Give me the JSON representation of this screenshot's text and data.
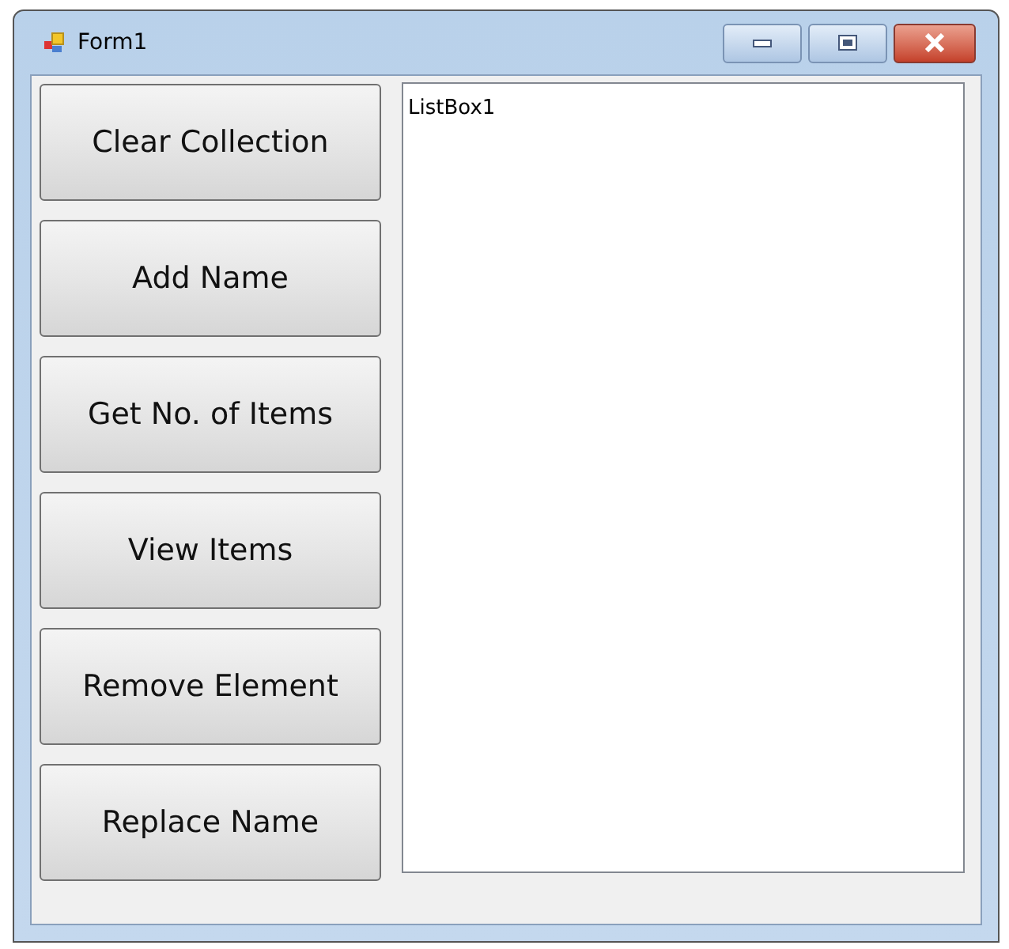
{
  "window": {
    "title": "Form1"
  },
  "buttons": [
    "Clear Collection",
    "Add Name",
    "Get No. of Items",
    "View Items",
    "Remove Element",
    "Replace Name"
  ],
  "listbox": {
    "label": "ListBox1"
  }
}
